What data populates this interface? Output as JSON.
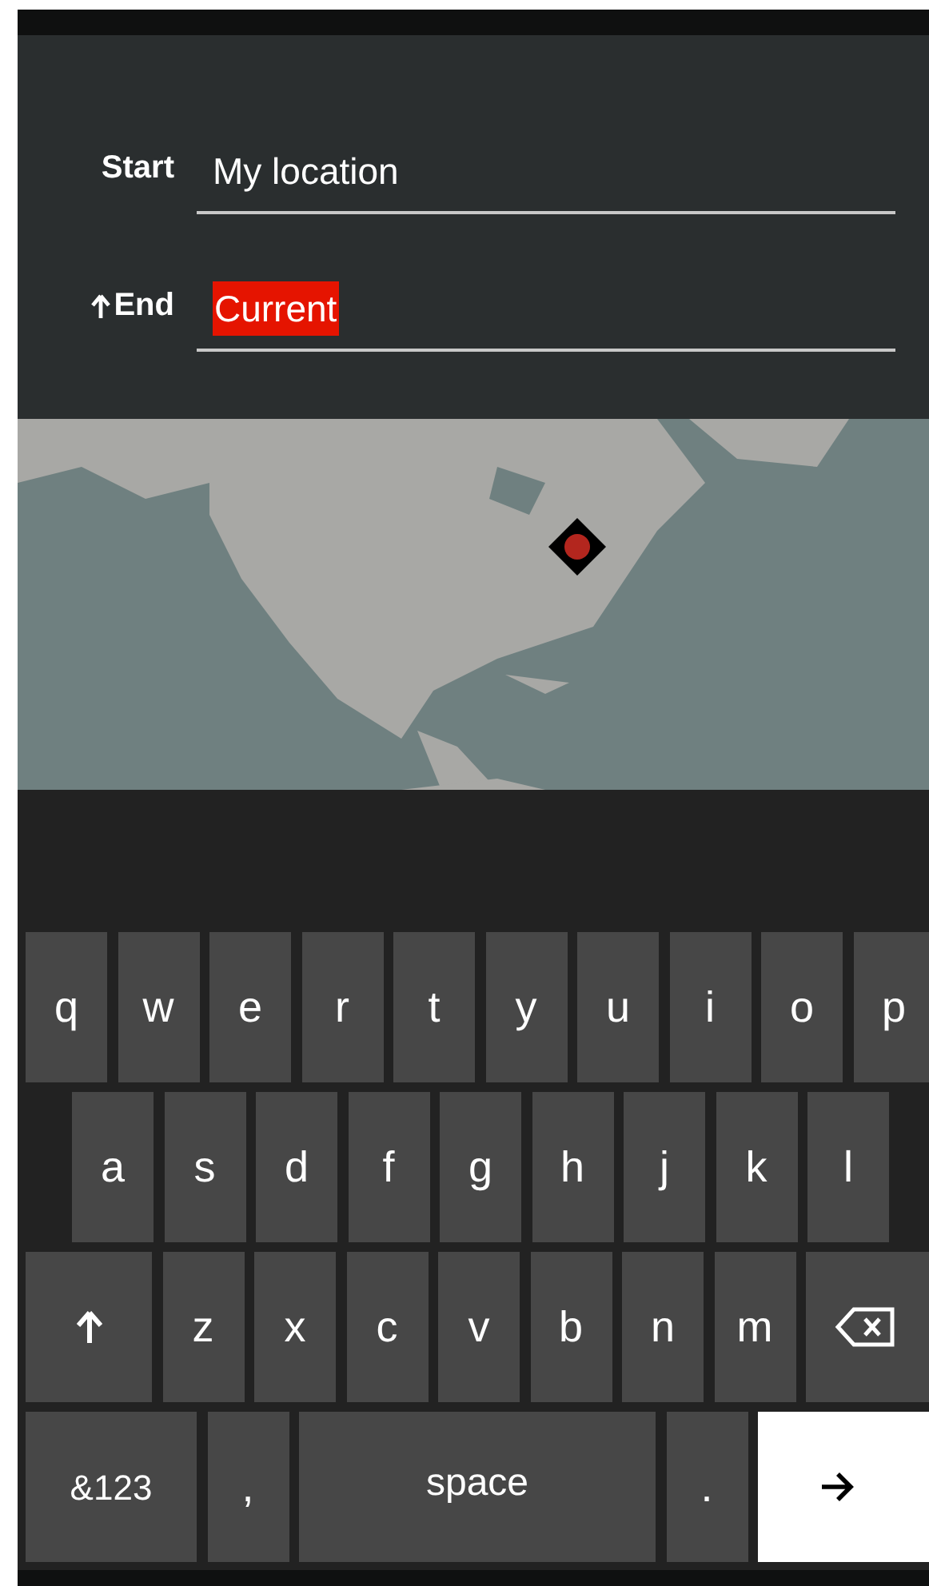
{
  "route": {
    "fields": [
      {
        "label": "Start",
        "value": "My location",
        "arrow": false,
        "selected": false
      },
      {
        "label": "End",
        "value": "Current",
        "arrow": true,
        "selected": true
      }
    ]
  },
  "keyboard": {
    "rows": [
      {
        "keys": [
          {
            "kind": "char",
            "label": "q"
          },
          {
            "kind": "char",
            "label": "w"
          },
          {
            "kind": "char",
            "label": "e"
          },
          {
            "kind": "char",
            "label": "r"
          },
          {
            "kind": "char",
            "label": "t"
          },
          {
            "kind": "char",
            "label": "y"
          },
          {
            "kind": "char",
            "label": "u"
          },
          {
            "kind": "char",
            "label": "i"
          },
          {
            "kind": "char",
            "label": "o"
          },
          {
            "kind": "char",
            "label": "p"
          }
        ]
      },
      {
        "keys": [
          {
            "kind": "char",
            "label": "a"
          },
          {
            "kind": "char",
            "label": "s"
          },
          {
            "kind": "char",
            "label": "d"
          },
          {
            "kind": "char",
            "label": "f"
          },
          {
            "kind": "char",
            "label": "g"
          },
          {
            "kind": "char",
            "label": "h"
          },
          {
            "kind": "char",
            "label": "j"
          },
          {
            "kind": "char",
            "label": "k"
          },
          {
            "kind": "char",
            "label": "l"
          }
        ]
      },
      {
        "keys": [
          {
            "kind": "shift"
          },
          {
            "kind": "char",
            "label": "z"
          },
          {
            "kind": "char",
            "label": "x"
          },
          {
            "kind": "char",
            "label": "c"
          },
          {
            "kind": "char",
            "label": "v"
          },
          {
            "kind": "char",
            "label": "b"
          },
          {
            "kind": "char",
            "label": "n"
          },
          {
            "kind": "char",
            "label": "m"
          },
          {
            "kind": "backspace"
          }
        ]
      },
      {
        "keys": [
          {
            "kind": "symbols",
            "label": "&123"
          },
          {
            "kind": "char",
            "label": ","
          },
          {
            "kind": "space",
            "label": "space"
          },
          {
            "kind": "char",
            "label": "."
          },
          {
            "kind": "enter"
          }
        ]
      }
    ]
  }
}
